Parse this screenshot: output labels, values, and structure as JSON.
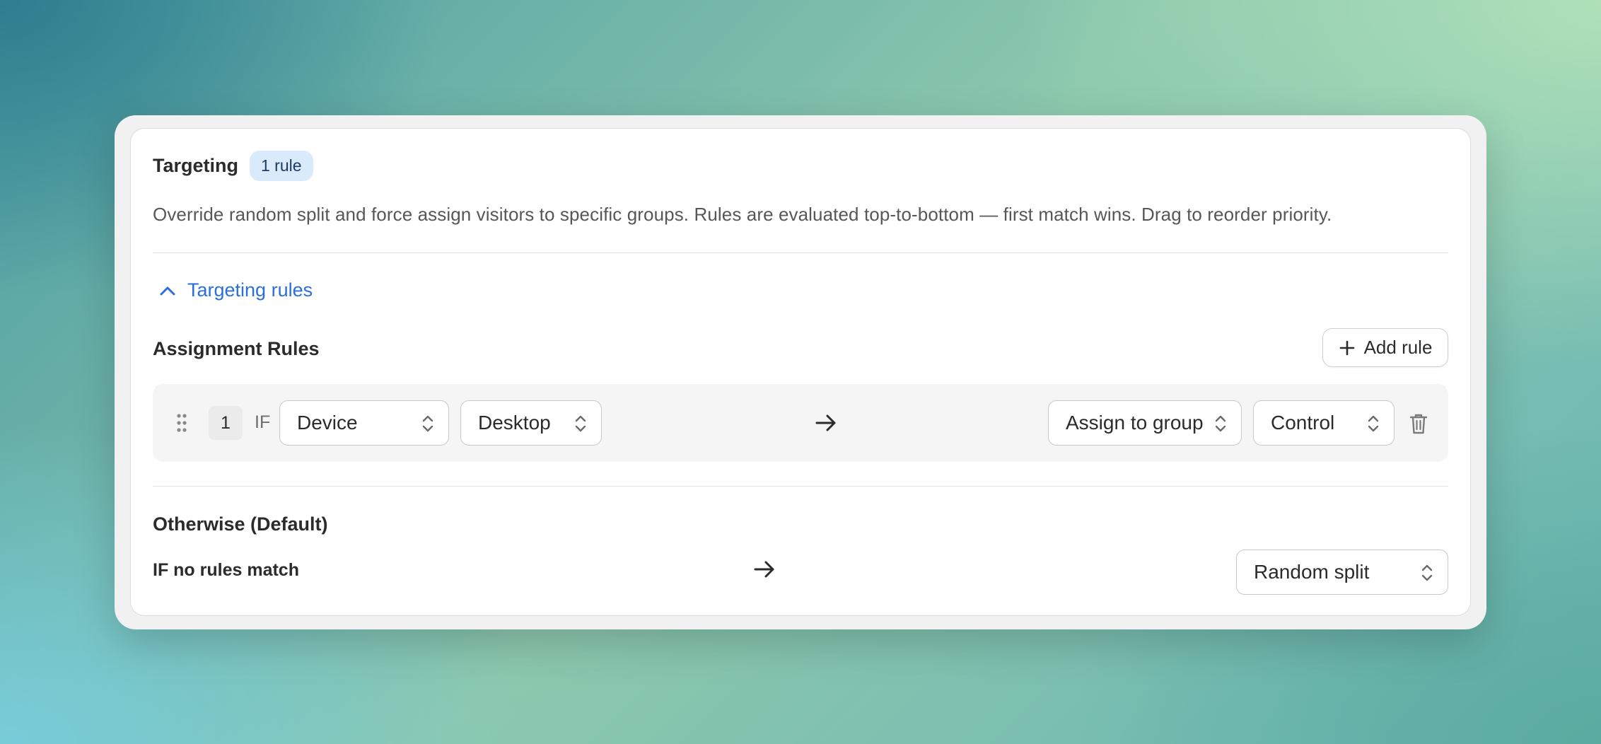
{
  "targeting": {
    "title": "Targeting",
    "badge": "1 rule",
    "description": "Override random split and force assign visitors to specific groups. Rules are evaluated top-to-bottom — first match wins. Drag to reorder priority."
  },
  "toggle": {
    "label": "Targeting rules",
    "icon": "chevron-up-icon"
  },
  "assignment": {
    "title": "Assignment Rules",
    "add_label": "Add rule",
    "rules": [
      {
        "number": "1",
        "if_label": "IF",
        "attribute": "Device",
        "value": "Desktop",
        "action": "Assign to group",
        "group": "Control"
      }
    ]
  },
  "otherwise": {
    "title": "Otherwise (Default)",
    "condition": "IF no rules match",
    "outcome": "Random split"
  },
  "colors": {
    "accent": "#2a6fdb",
    "badge_bg": "#d9ebfb",
    "row_bg": "#f5f5f5"
  }
}
